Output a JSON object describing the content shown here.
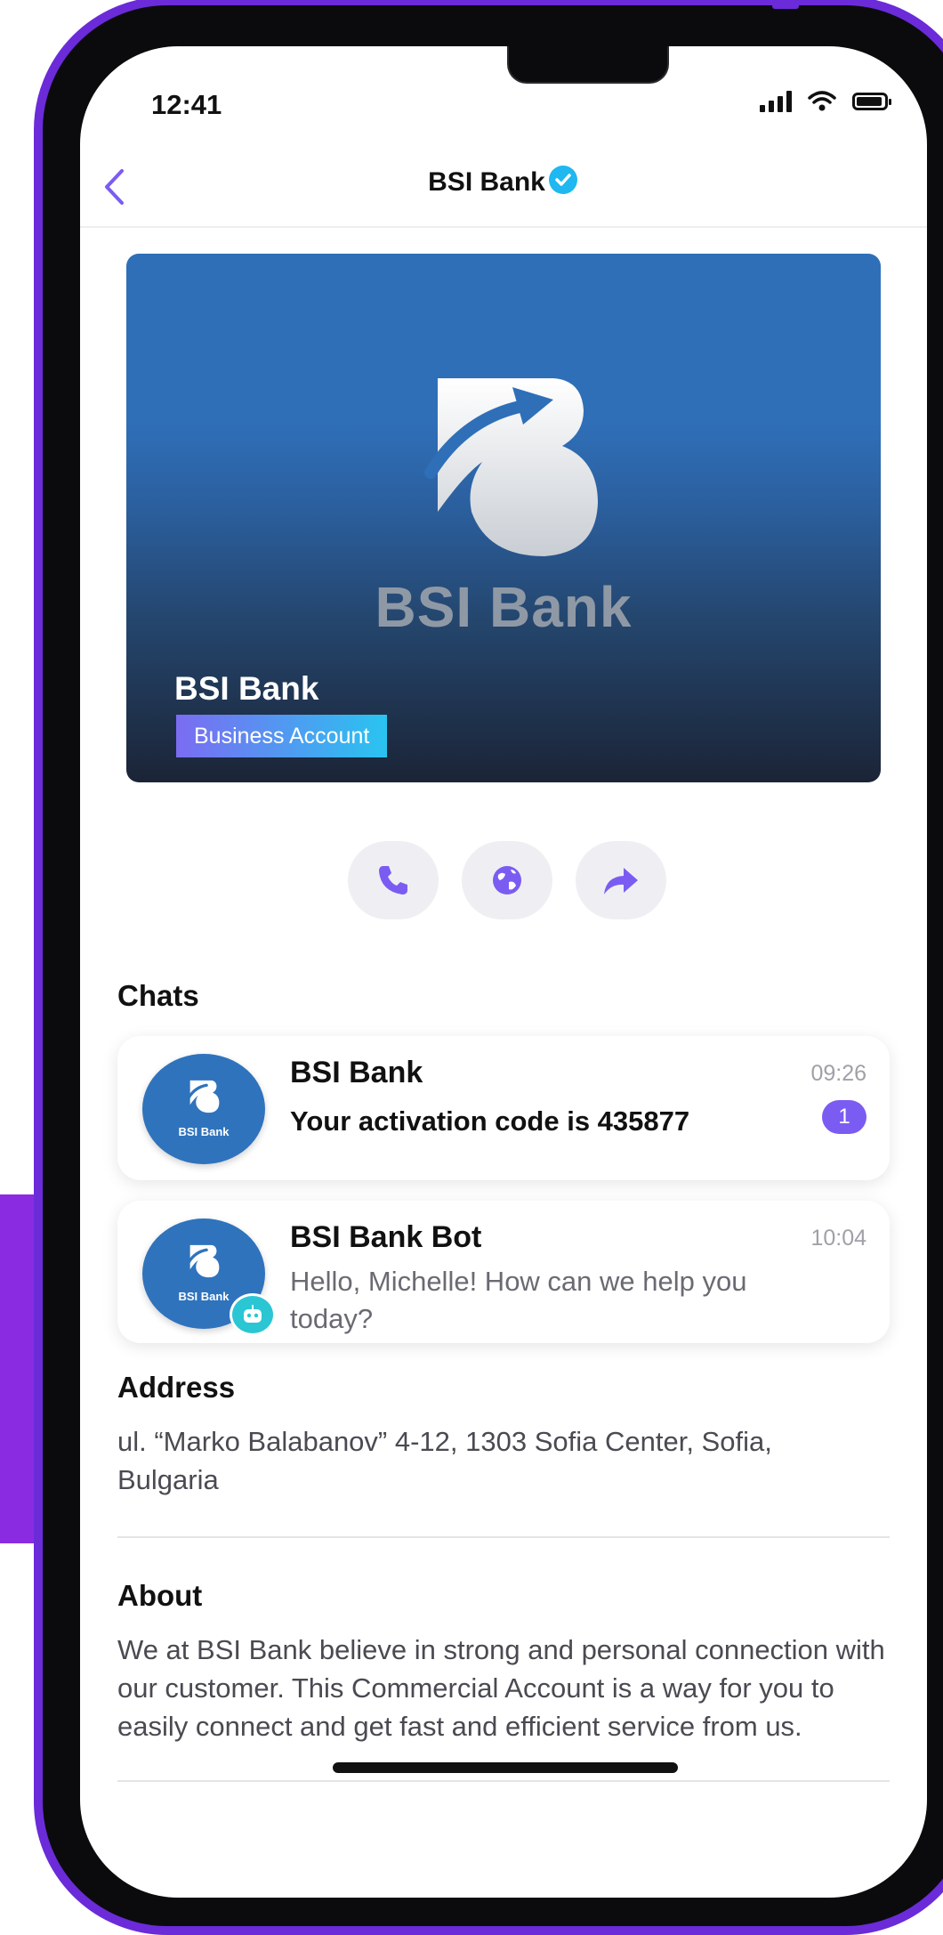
{
  "status_bar": {
    "time": "12:41"
  },
  "nav": {
    "title": "BSI Bank"
  },
  "hero": {
    "watermark": "BSI Bank",
    "name": "BSI Bank",
    "badge": "Business Account"
  },
  "actions": [
    {
      "icon": "phone-icon"
    },
    {
      "icon": "globe-icon"
    },
    {
      "icon": "share-icon"
    }
  ],
  "chats": {
    "title": "Chats",
    "items": [
      {
        "name": "BSI Bank",
        "avatar_label": "BSI Bank",
        "message": "Your activation code is 435877",
        "time": "09:26",
        "unread": "1"
      },
      {
        "name": "BSI Bank Bot",
        "avatar_label": "BSI Bank",
        "message": "Hello, Michelle! How can we help you today?",
        "time": "10:04"
      }
    ]
  },
  "address": {
    "title": "Address",
    "text": "ul. “Marko Balabanov” 4-12, 1303 Sofia Center, Sofia, Bulgaria"
  },
  "about": {
    "title": "About",
    "text": "We at BSI Bank believe in strong and personal connection with our customer. This Commercial Account is a way for you to easily connect and get fast and efficient service from us."
  },
  "colors": {
    "accent": "#7b5cf2",
    "frame": "#6b2bd9",
    "brand_blue": "#2f73bd",
    "verified": "#1fb8f0"
  }
}
